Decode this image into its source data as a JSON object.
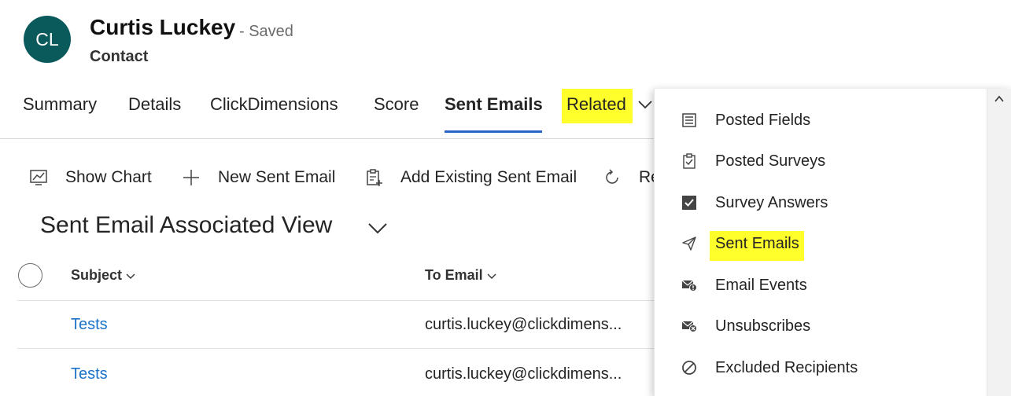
{
  "record": {
    "initials": "CL",
    "name": "Curtis Luckey",
    "status": "- Saved",
    "entity": "Contact",
    "avatar_color": "#0b5a5b"
  },
  "tabs": [
    {
      "label": "Summary",
      "active": false
    },
    {
      "label": "Details",
      "active": false
    },
    {
      "label": "ClickDimensions",
      "active": false
    },
    {
      "label": "Score",
      "active": false
    },
    {
      "label": "Sent Emails",
      "active": true
    },
    {
      "label": "Related",
      "active": false,
      "highlighted": true,
      "icon": "chevron-down-icon"
    }
  ],
  "commands": [
    {
      "label": "Show Chart",
      "icon": "chart-icon"
    },
    {
      "label": "New Sent Email",
      "icon": "plus-icon"
    },
    {
      "label": "Add Existing Sent Email",
      "icon": "clipboard-add-icon"
    },
    {
      "label": "Re",
      "icon": "refresh-icon"
    }
  ],
  "view": {
    "title": "Sent Email Associated View",
    "icon": "chevron-down-icon"
  },
  "grid": {
    "columns": [
      "Subject",
      "To Email"
    ],
    "rows": [
      {
        "subject": "Tests",
        "to_email": "curtis.luckey@clickdimens..."
      },
      {
        "subject": "Tests",
        "to_email": "curtis.luckey@clickdimens..."
      }
    ]
  },
  "related_menu": {
    "items": [
      {
        "label": "Posted Fields",
        "icon": "list-icon"
      },
      {
        "label": "Posted Surveys",
        "icon": "clipboard-check-icon"
      },
      {
        "label": "Survey Answers",
        "icon": "checkbox-icon"
      },
      {
        "label": "Sent Emails",
        "icon": "send-icon",
        "highlighted": true
      },
      {
        "label": "Email Events",
        "icon": "mail-alert-icon"
      },
      {
        "label": "Unsubscribes",
        "icon": "mail-remove-icon"
      },
      {
        "label": "Excluded Recipients",
        "icon": "blocked-icon"
      }
    ]
  },
  "colors": {
    "accent": "#2b64c8",
    "link": "#1a73c8",
    "highlight": "#ffff2b"
  }
}
